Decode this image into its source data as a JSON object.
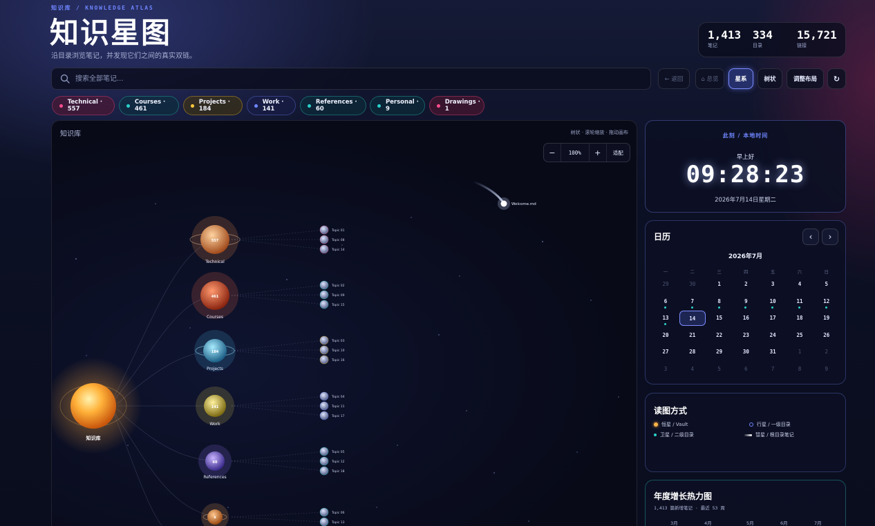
{
  "header": {
    "eyebrow": "知识库 / KNOWLEDGE ATLAS",
    "title": "知识星图",
    "subtitle": "沿目录浏览笔记，并发现它们之间的真实双链。"
  },
  "stats": [
    {
      "value": "1,413",
      "label": "笔记"
    },
    {
      "value": "334",
      "label": "目录"
    },
    {
      "value": "15,721",
      "label": "链接"
    }
  ],
  "search": {
    "placeholder": "搜索全部笔记...",
    "icon": "search-icon"
  },
  "toolbar": {
    "back": "← 返回",
    "overview": "⌂ 总览",
    "galaxy": "星系",
    "tree": "树状",
    "adjust": "调整布局",
    "refresh": "↻"
  },
  "categories": [
    {
      "label": "Technical · 557",
      "color": "#ff4d8d"
    },
    {
      "label": "Courses · 461",
      "color": "#2ad1c9"
    },
    {
      "label": "Projects · 184",
      "color": "#ffc93c"
    },
    {
      "label": "Work · 141",
      "color": "#6f86ff"
    },
    {
      "label": "References · 60",
      "color": "#2ad1c9"
    },
    {
      "label": "Personal · 9",
      "color": "#2ad1c9"
    },
    {
      "label": "Drawings · 1",
      "color": "#ff4d8d"
    }
  ],
  "map": {
    "panel_label": "知识库",
    "hints": "树状 · 滚轮缩放 · 拖动画布",
    "zoom_out": "−",
    "zoom_level": "100%",
    "zoom_in": "+",
    "fit": "适配",
    "sun_label": "知识库",
    "comet_label": "Welcome.md",
    "planets": [
      {
        "name": "Technical",
        "count": "557",
        "topics": [
          "Topic 01",
          "Topic 08",
          "Topic 14"
        ]
      },
      {
        "name": "Courses",
        "count": "461",
        "topics": [
          "Topic 02",
          "Topic 09",
          "Topic 15"
        ]
      },
      {
        "name": "Projects",
        "count": "184",
        "topics": [
          "Topic 03",
          "Topic 10",
          "Topic 16"
        ]
      },
      {
        "name": "Work",
        "count": "141",
        "topics": [
          "Topic 04",
          "Topic 11",
          "Topic 17"
        ]
      },
      {
        "name": "References",
        "count": "60",
        "topics": [
          "Topic 05",
          "Topic 12",
          "Topic 18"
        ]
      },
      {
        "name": "Personal",
        "count": "9",
        "topics": [
          "Topic 06",
          "Topic 13"
        ]
      }
    ]
  },
  "clock": {
    "caption": "此刻 / 本地时间",
    "greeting": "早上好",
    "time": "09:28:23",
    "date": "2026年7月14日星期二"
  },
  "calendar": {
    "title": "日历",
    "month": "2026年7月",
    "prev": "‹",
    "next": "›",
    "weekdays": [
      "一",
      "二",
      "三",
      "四",
      "五",
      "六",
      "日"
    ],
    "days": [
      [
        "29",
        "30",
        "1",
        "2",
        "3",
        "4",
        "5"
      ],
      [
        "6",
        "7",
        "8",
        "9",
        "10",
        "11",
        "12"
      ],
      [
        "13",
        "14",
        "15",
        "16",
        "17",
        "18",
        "19"
      ],
      [
        "20",
        "21",
        "22",
        "23",
        "24",
        "25",
        "26"
      ],
      [
        "27",
        "28",
        "29",
        "30",
        "31",
        "1",
        "2"
      ],
      [
        "3",
        "4",
        "5",
        "6",
        "7",
        "8",
        "9"
      ]
    ],
    "today": "14"
  },
  "legend": {
    "title": "读图方式",
    "items": [
      {
        "label": "恒星 / Vault",
        "color": "#ffb347"
      },
      {
        "label": "行星 / 一级目录",
        "color": "#6f86ff"
      },
      {
        "label": "卫星 / 二级目录",
        "color": "#2ad1c9"
      },
      {
        "label": "彗星 / 根目录笔记",
        "color": "#ffffff"
      }
    ]
  },
  "heatmap": {
    "title": "年度增长热力图",
    "summary": "1,413 篇新增笔记 · 最近 53 周",
    "months": [
      "3月",
      "4月",
      "5月",
      "6月",
      "7月"
    ]
  }
}
